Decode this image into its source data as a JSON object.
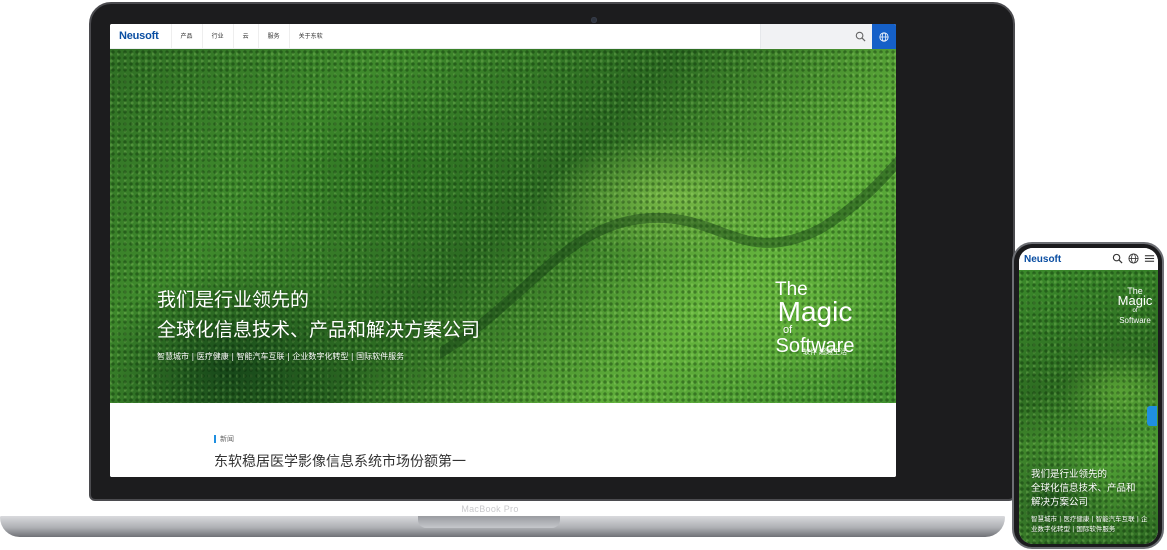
{
  "laptop": {
    "model_label": "MacBook Pro",
    "site": {
      "logo": "Neusoft",
      "nav": [
        "产品",
        "行业",
        "云",
        "服务",
        "关于东软"
      ],
      "hero": {
        "title_line1": "我们是行业领先的",
        "title_line2": "全球化信息技术、产品和解决方案公司",
        "subtitle": "智慧城市 | 医疗健康 | 智能汽车互联 | 企业数字化转型 | 国际软件服务",
        "magic": {
          "the": "The",
          "magic": "Magic",
          "of": "of",
          "software": "Software",
          "cn": "软件 超越生活"
        }
      },
      "news": {
        "tag": "新闻",
        "title": "东软稳居医学影像信息系统市场份额第一"
      }
    }
  },
  "phone": {
    "logo": "Neusoft",
    "hero": {
      "title_line1": "我们是行业领先的",
      "title_line2": "全球化信息技术、产品和",
      "title_line3": "解决方案公司",
      "subtitle": "智慧城市 | 医疗健康 | 智能汽车互联 | 企业数字化转型 | 国际软件服务",
      "magic": {
        "the": "The",
        "magic": "Magic",
        "of": "of",
        "software": "Software"
      }
    }
  },
  "colors": {
    "brand_blue": "#0a4ea2",
    "globe_button": "#1560c8",
    "accent": "#1f8fe0"
  }
}
